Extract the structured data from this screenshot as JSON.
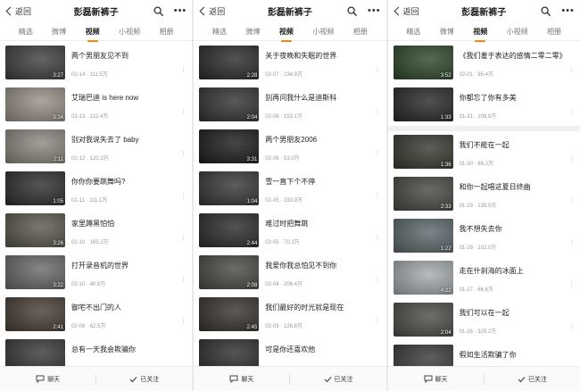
{
  "header": {
    "back_label": "返回",
    "title": "彭磊新裤子"
  },
  "tabs": [
    "精选",
    "微博",
    "视频",
    "小视频",
    "相册"
  ],
  "active_tab_index": 2,
  "accent_color": "#ff8200",
  "footer": {
    "chat_label": "聊天",
    "followed_label": "已关注"
  },
  "screens": [
    {
      "videos": [
        {
          "title": "两个男朋友见不到",
          "date": "02-14",
          "views": "111.5万",
          "duration": "3:27",
          "thumb": "#3e423e"
        },
        {
          "title": "艾瑞巴迪 is here now",
          "date": "02-13",
          "views": "112.4万",
          "duration": "3:24",
          "thumb": "#9a9288"
        },
        {
          "title": "别对我说失去了 baby",
          "date": "02-12",
          "views": "120.3万",
          "duration": "2:11",
          "thumb": "#8d8a80"
        },
        {
          "title": "你你你要跳舞吗?",
          "date": "02-11",
          "views": "111.1万",
          "duration": "1:05",
          "thumb": "#2f312d"
        },
        {
          "title": "家里蹲黑怕怕",
          "date": "02-10",
          "views": "165.2万",
          "duration": "3:26",
          "thumb": "#5c5a4e"
        },
        {
          "title": "打开录音机的世界",
          "date": "02-10",
          "views": "40.8万",
          "duration": "3:22",
          "thumb": "#6b6b6b"
        },
        {
          "title": "御宅不出门的人",
          "date": "02-09",
          "views": "62.5万",
          "duration": "2:41",
          "thumb": "#4a3f36"
        },
        {
          "title": "总有一天我会欺骗你",
          "date": "",
          "views": "",
          "duration": "",
          "thumb": "#3a3a3a"
        }
      ]
    },
    {
      "videos": [
        {
          "title": "关于夜晚和失眠的世界",
          "date": "02-07",
          "views": "234.9万",
          "duration": "2:28",
          "thumb": "#2b2e2a"
        },
        {
          "title": "别再问我什么是迪斯科",
          "date": "02-06",
          "views": "153.1万",
          "duration": "2:04",
          "thumb": "#353535"
        },
        {
          "title": "两个男朋友2006",
          "date": "02-06",
          "views": "53.0万",
          "duration": "3:31",
          "thumb": "#1d1f1c"
        },
        {
          "title": "雪一直下个不停",
          "date": "02-05",
          "views": "333.9万",
          "duration": "1:04",
          "thumb": "#3a3936"
        },
        {
          "title": "难过时把舞跳",
          "date": "02-05",
          "views": "70.3万",
          "duration": "2:44",
          "thumb": "#2e2f2c"
        },
        {
          "title": "我爱你我总怕见不到你",
          "date": "02-04",
          "views": "206.4万",
          "duration": "2:08",
          "thumb": "#4b4b47"
        },
        {
          "title": "我们最好的时光就是现在",
          "date": "02-03",
          "views": "126.8万",
          "duration": "2:45",
          "thumb": "#3a352f"
        },
        {
          "title": "可是你还喜欢他",
          "date": "",
          "views": "",
          "duration": "",
          "thumb": "#303030"
        }
      ]
    },
    {
      "videos": [
        {
          "title": "《我们羞于表达的感情二零二零》",
          "date": "02-01",
          "views": "95.4万",
          "duration": "3:52",
          "thumb": "#2f4a2c"
        },
        {
          "title": "你都忘了你有多美",
          "date": "01-31",
          "views": "108.8万",
          "duration": "1:33",
          "thumb": "#2a2a2a"
        },
        {
          "title": "我们不能在一起",
          "date": "01-30",
          "views": "86.2万",
          "duration": "1:36",
          "thumb": "#3b3a33"
        },
        {
          "title": "和你一起唱这夏日终曲",
          "date": "01-29",
          "views": "139.9万",
          "duration": "2:33",
          "thumb": "#4a4a44"
        },
        {
          "title": "我不想失去你",
          "date": "01-28",
          "views": "102.0万",
          "duration": "1:22",
          "thumb": "#5e6a6e"
        },
        {
          "title": "走在什刹海的冰面上",
          "date": "01-27",
          "views": "66.6万",
          "duration": "4:22",
          "thumb": "#a7adb0"
        },
        {
          "title": "我们可以在一起",
          "date": "01-26",
          "views": "325.2万",
          "duration": "2:04",
          "thumb": "#4e4e4a"
        },
        {
          "title": "假如生活欺骗了你",
          "date": "",
          "views": "",
          "duration": "",
          "thumb": "#3c3c3c"
        }
      ]
    }
  ]
}
